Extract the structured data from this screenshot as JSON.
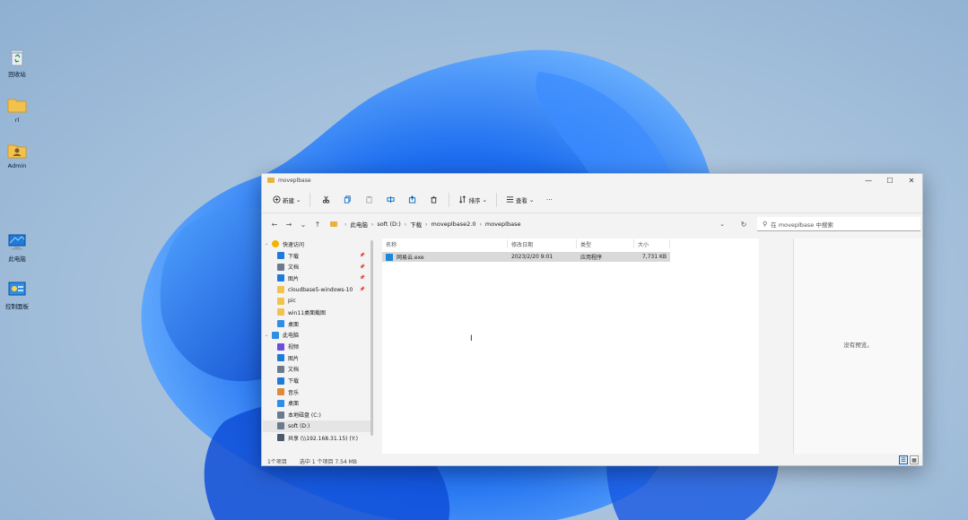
{
  "desktop": {
    "icons": [
      {
        "label": "回收站",
        "icon": "recycle-bin-icon"
      },
      {
        "label": "rl",
        "icon": "folder-icon"
      },
      {
        "label": "Admin",
        "icon": "user-folder-icon"
      },
      {
        "label": "此电脑",
        "icon": "this-pc-icon"
      },
      {
        "label": "控制面板",
        "icon": "control-panel-icon"
      }
    ]
  },
  "window": {
    "title": "moveplbase",
    "controls": {
      "minimize": "—",
      "maximize": "☐",
      "close": "✕"
    },
    "toolbar": {
      "new_label": "新建",
      "sort_label": "排序",
      "view_label": "查看",
      "more_label": "···"
    },
    "nav": {
      "back": "←",
      "forward": "→",
      "recent": "⌄",
      "up": "↑"
    },
    "breadcrumb": [
      "此电脑",
      "soft (D:)",
      "下载",
      "moveplbase2.0",
      "moveplbase"
    ],
    "refresh": "↻",
    "search_placeholder": "在 moveplbase 中搜索",
    "navpane": [
      {
        "label": "快速访问",
        "icon": "star-icon",
        "section": true,
        "expanded": true
      },
      {
        "label": "下载",
        "icon": "download-icon",
        "pinned": true
      },
      {
        "label": "文档",
        "icon": "document-icon",
        "pinned": true
      },
      {
        "label": "图片",
        "icon": "pictures-icon",
        "pinned": true
      },
      {
        "label": "cloudbase5-windows-10",
        "icon": "folder-icon",
        "pinned": true
      },
      {
        "label": "pic",
        "icon": "folder-icon",
        "pinned": false
      },
      {
        "label": "win11桌面截图",
        "icon": "folder-icon",
        "pinned": false
      },
      {
        "label": "桌面",
        "icon": "desktop-icon",
        "pinned": false
      },
      {
        "label": "此电脑",
        "icon": "computer-icon",
        "section": true,
        "expanded": true
      },
      {
        "label": "视频",
        "icon": "video-icon"
      },
      {
        "label": "图片",
        "icon": "pictures-icon"
      },
      {
        "label": "文档",
        "icon": "document-icon"
      },
      {
        "label": "下载",
        "icon": "download-icon"
      },
      {
        "label": "音乐",
        "icon": "music-icon"
      },
      {
        "label": "桌面",
        "icon": "desktop-icon"
      },
      {
        "label": "本地磁盘 (C:)",
        "icon": "drive-icon"
      },
      {
        "label": "soft (D:)",
        "icon": "drive-icon",
        "selected": true
      },
      {
        "label": "共享 (\\\\192.168.31.15) (Y:)",
        "icon": "network-drive-icon"
      }
    ],
    "columns": [
      "名称",
      "修改日期",
      "类型",
      "大小"
    ],
    "files": [
      {
        "name": "网易云.exe",
        "modified": "2023/2/20 9:01",
        "type": "应用程序",
        "size": "7,731 KB",
        "selected": true
      }
    ],
    "preview_text": "没有预览。",
    "status": {
      "count": "1个项目",
      "selected": "选中 1 个项目 7.54 MB"
    },
    "view_buttons": {
      "details": "☰",
      "tiles": "▦"
    }
  },
  "colors": {
    "accent": "#0067c0",
    "folder": "#e8b23c",
    "bloom": "#1a5fe0"
  }
}
